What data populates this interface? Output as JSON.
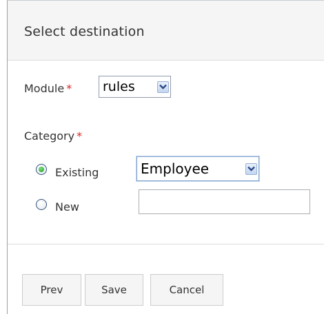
{
  "dialog": {
    "title": "Select destination"
  },
  "module": {
    "label": "Module",
    "required_mark": "*",
    "selected": "rules"
  },
  "category": {
    "label": "Category",
    "required_mark": "*",
    "options": [
      {
        "label": "Existing",
        "checked": true
      },
      {
        "label": "New",
        "checked": false
      }
    ],
    "existing_selected": "Employee",
    "new_value": "",
    "new_placeholder": ""
  },
  "buttons": {
    "prev": "Prev",
    "save": "Save",
    "cancel": "Cancel"
  },
  "icons": {
    "dropdown": "chevron-down-icon",
    "radio_checked": "radio-checked-icon",
    "radio_unchecked": "radio-unchecked-icon"
  },
  "colors": {
    "required": "#dd2222",
    "radio_selected": "#1f9a2a",
    "dropdown_arrow": "#2b4a86"
  }
}
